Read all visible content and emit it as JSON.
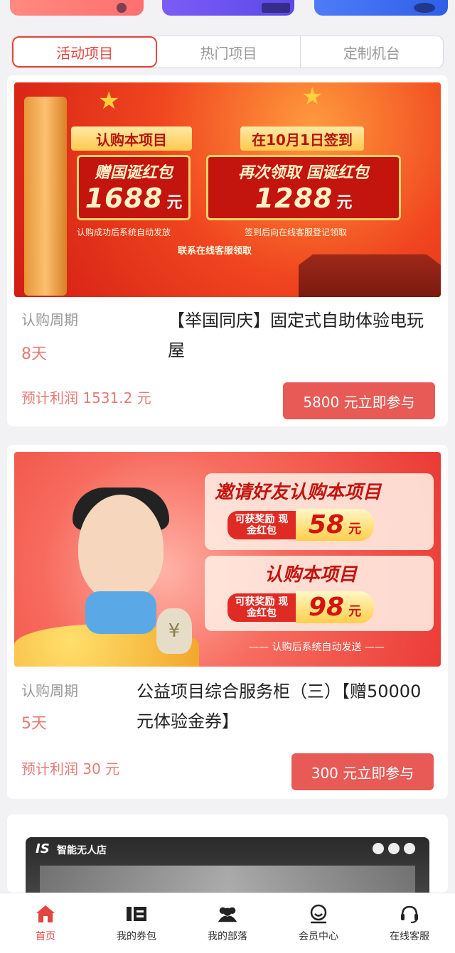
{
  "tabs": [
    {
      "label": "活动项目",
      "active": true
    },
    {
      "label": "热门项目",
      "active": false
    },
    {
      "label": "定制机台",
      "active": false
    }
  ],
  "projects": [
    {
      "banner": {
        "ribbon_left": "认购本项目",
        "box_left_title": "赠国诞红包",
        "box_left_amount": "1688",
        "box_left_unit": "元",
        "note_left": "认购成功后系统自动发放",
        "ribbon_right": "在10月1日签到",
        "box_right_title": "再次领取 国诞红包",
        "box_right_amount": "1288",
        "box_right_unit": "元",
        "note_right": "签到后向在线客服登记领取",
        "footer": "联系在线客服领取"
      },
      "period_label": "认购周期",
      "period_value": "8天",
      "title": "【举国同庆】固定式自助体验电玩屋",
      "profit": "预计利润 1531.2 元",
      "button": "5800 元立即参与"
    },
    {
      "banner": {
        "headline1": "邀请好友认购本项目",
        "tag": "可获奖励 现金红包",
        "amount1": "58",
        "unit": "元",
        "headline2": "认购本项目",
        "amount2": "98",
        "footer": "—— 认购后系统自动发送 ——",
        "bag_symbol": "¥"
      },
      "period_label": "认购周期",
      "period_value": "5天",
      "title": "公益项目综合服务柜（三）【赠50000元体验金券】",
      "profit": "预计利润 30 元",
      "button": "300 元立即参与"
    }
  ],
  "store_preview": {
    "brand": "智能无人店",
    "logo": "IS"
  },
  "nav": [
    {
      "label": "首页",
      "icon": "home-icon",
      "active": true
    },
    {
      "label": "我的券包",
      "icon": "coupon-icon",
      "active": false
    },
    {
      "label": "我的部落",
      "icon": "group-icon",
      "active": false
    },
    {
      "label": "会员中心",
      "icon": "member-icon",
      "active": false
    },
    {
      "label": "在线客服",
      "icon": "headset-icon",
      "active": false
    }
  ],
  "colors": {
    "accent": "#e2463f",
    "button": "#e85a55",
    "muted_red": "#e77a74"
  }
}
